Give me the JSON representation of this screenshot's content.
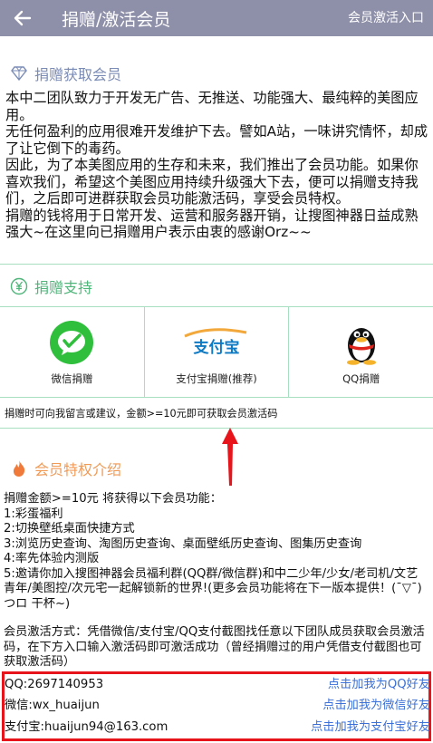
{
  "header": {
    "title": "捐赠/激活会员",
    "entry_label": "会员激活入口"
  },
  "donate_section": {
    "title": "捐赠获取会员",
    "paragraphs": [
      "本中二团队致力于开发无广告、无推送、功能强大、最纯粹的美图应用。",
      "无任何盈利的应用很难开发维护下去。譬如A站，一味讲究情怀，却成了让它倒下的毒药。",
      "因此，为了本美图应用的生存和未来，我们推出了会员功能。如果你喜欢我们，希望这个美图应用持续升级强大下去，便可以捐赠支持我们，之后即可进群获取会员功能激活码，享受会员特权。",
      "捐赠的钱将用于日常开发、运营和服务器开销，让搜图神器日益成熟强大~在这里向已捐赠用户表示由衷的感谢Orz~~"
    ]
  },
  "support_section": {
    "title": "捐赠支持",
    "options": [
      {
        "label": "微信捐赠",
        "icon": "wechat-icon"
      },
      {
        "label": "支付宝捐赠(推荐)",
        "icon": "alipay-logo",
        "logo_text": "支付宝"
      },
      {
        "label": "QQ捐赠",
        "icon": "qq-penguin-icon"
      }
    ],
    "tip": "捐赠时可向我留言或建议，金额>=10元即可获取会员激活码"
  },
  "perks_section": {
    "title": "会员特权介绍",
    "lines": [
      "捐赠金额>=10元 将获得以下会员功能：",
      "1:彩蛋福利",
      " 2:切换壁纸桌面快捷方式",
      " 3:浏览历史查询、淘图历史查询、桌面壁纸历史查询、图集历史查询",
      " 4:率先体验内测版",
      " 5:邀请你加入搜图神器会员福利群(QQ群/微信群)和中二少年/少女/老司机/文艺青年/美图控/次元宅一起解锁新的世界!(更多会员功能将在下一版本提供！(ˉ▽ˉ)つロ 干杯~)"
    ],
    "activation_text": "会员激活方式：凭借微信/支付宝/QQ支付截图找任意以下团队成员获取会员激活码，在下方入口输入激活码即可激活成功（曾经捐赠过的用户凭借支付截图也可获取激活码）"
  },
  "contacts": [
    {
      "id": "QQ:2697140953",
      "action": "点击加我为QQ好友"
    },
    {
      "id": "微信:wx_huaijun",
      "action": "点击加我为微信好友"
    },
    {
      "id": "支付宝:huaijun94@163.com",
      "action": "点击加我为支付宝好友"
    }
  ],
  "colors": {
    "header_bg": "#8e8fa8",
    "section1": "#7a8bb5",
    "section2": "#4fb57a",
    "section3": "#f09a55",
    "link": "#3a70d8",
    "highlight_border": "#e8141c"
  }
}
